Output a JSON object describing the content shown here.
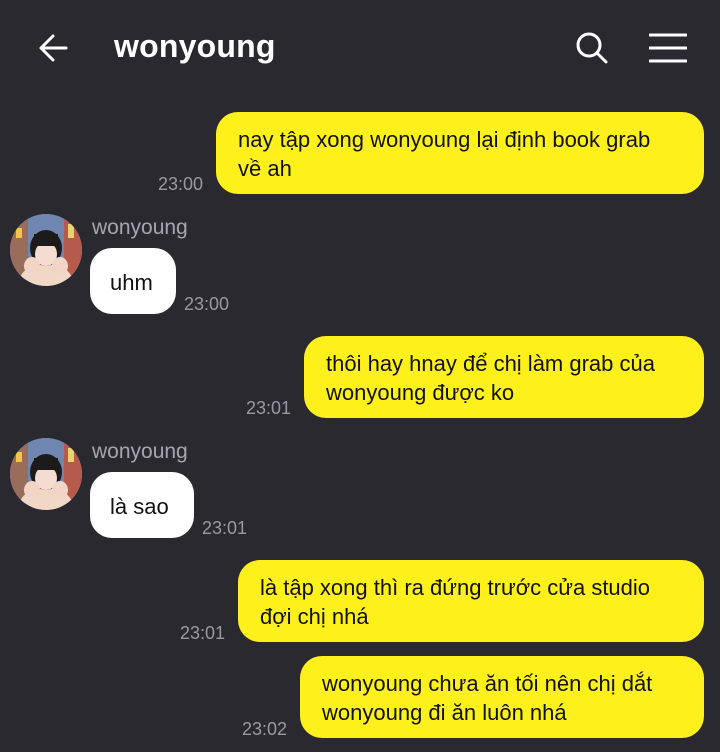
{
  "header": {
    "title": "wonyoung",
    "back_icon": "arrow-left-icon",
    "search_icon": "search-icon",
    "menu_icon": "hamburger-menu-icon"
  },
  "colors": {
    "background": "#2b2930",
    "outgoing_bubble": "#fef01b",
    "incoming_bubble": "#ffffff",
    "timestamp": "#9a98a0"
  },
  "messages": [
    {
      "direction": "outgoing",
      "lines": [
        "nay tập xong wonyoung lại định book grab",
        "về ah"
      ],
      "time": "23:00"
    },
    {
      "direction": "incoming",
      "sender": "wonyoung",
      "lines": [
        "uhm"
      ],
      "time": "23:00"
    },
    {
      "direction": "outgoing",
      "lines": [
        "thôi hay hnay để chị làm grab của",
        "wonyoung được ko"
      ],
      "time": "23:01"
    },
    {
      "direction": "incoming",
      "sender": "wonyoung",
      "lines": [
        "là sao"
      ],
      "time": "23:01"
    },
    {
      "direction": "outgoing",
      "lines": [
        "là tập xong thì ra đứng trước cửa studio",
        "đợi chị nhá"
      ],
      "time": "23:01"
    },
    {
      "direction": "outgoing",
      "lines": [
        "wonyoung chưa ăn tối nên chị dắt",
        "wonyoung đi ăn luôn nhá"
      ],
      "time": "23:02"
    }
  ]
}
